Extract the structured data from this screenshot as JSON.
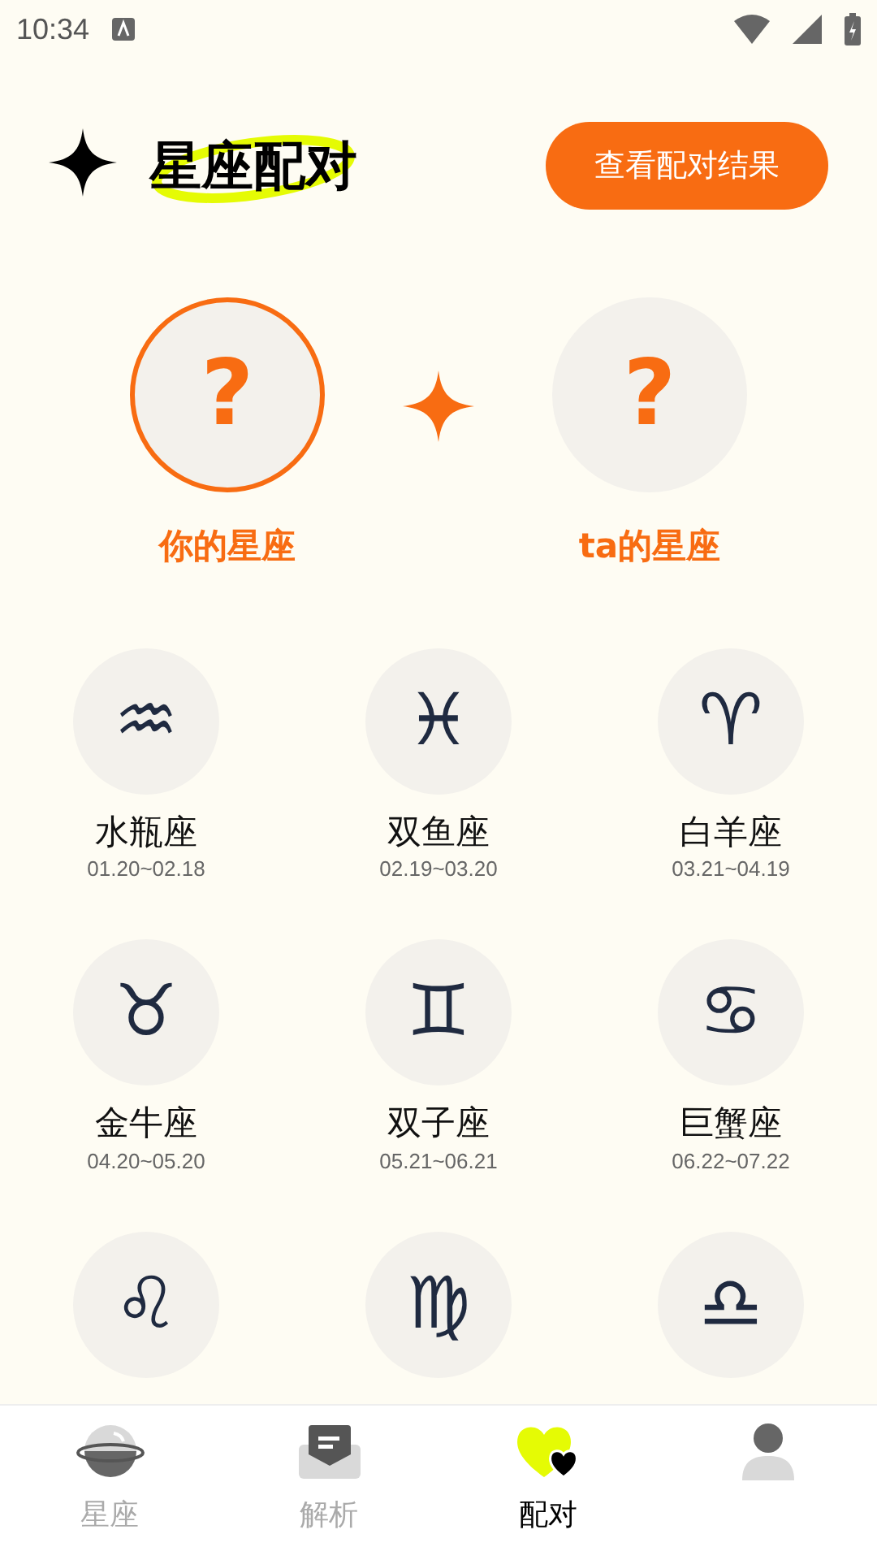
{
  "status_bar": {
    "time": "10:34"
  },
  "header": {
    "title": "星座配对",
    "button": "查看配对结果"
  },
  "pickers": [
    {
      "label": "你的星座",
      "symbol": "?",
      "selected": true
    },
    {
      "label": "ta的星座",
      "symbol": "?",
      "selected": false
    }
  ],
  "signs": [
    {
      "symbol": "♒",
      "name": "水瓶座",
      "dates": "01.20~02.18"
    },
    {
      "symbol": "♓",
      "name": "双鱼座",
      "dates": "02.19~03.20"
    },
    {
      "symbol": "♈",
      "name": "白羊座",
      "dates": "03.21~04.19"
    },
    {
      "symbol": "♉",
      "name": "金牛座",
      "dates": "04.20~05.20"
    },
    {
      "symbol": "♊",
      "name": "双子座",
      "dates": "05.21~06.21"
    },
    {
      "symbol": "♋",
      "name": "巨蟹座",
      "dates": "06.22~07.22"
    },
    {
      "symbol": "♌"
    },
    {
      "symbol": "♍"
    },
    {
      "symbol": "♎"
    }
  ],
  "nav": [
    {
      "kind": "planet",
      "label": "星座",
      "selected": false
    },
    {
      "kind": "mail",
      "label": "解析",
      "selected": false
    },
    {
      "kind": "hearts",
      "label": "配对",
      "selected": true
    },
    {
      "kind": "person",
      "selected": false
    }
  ]
}
